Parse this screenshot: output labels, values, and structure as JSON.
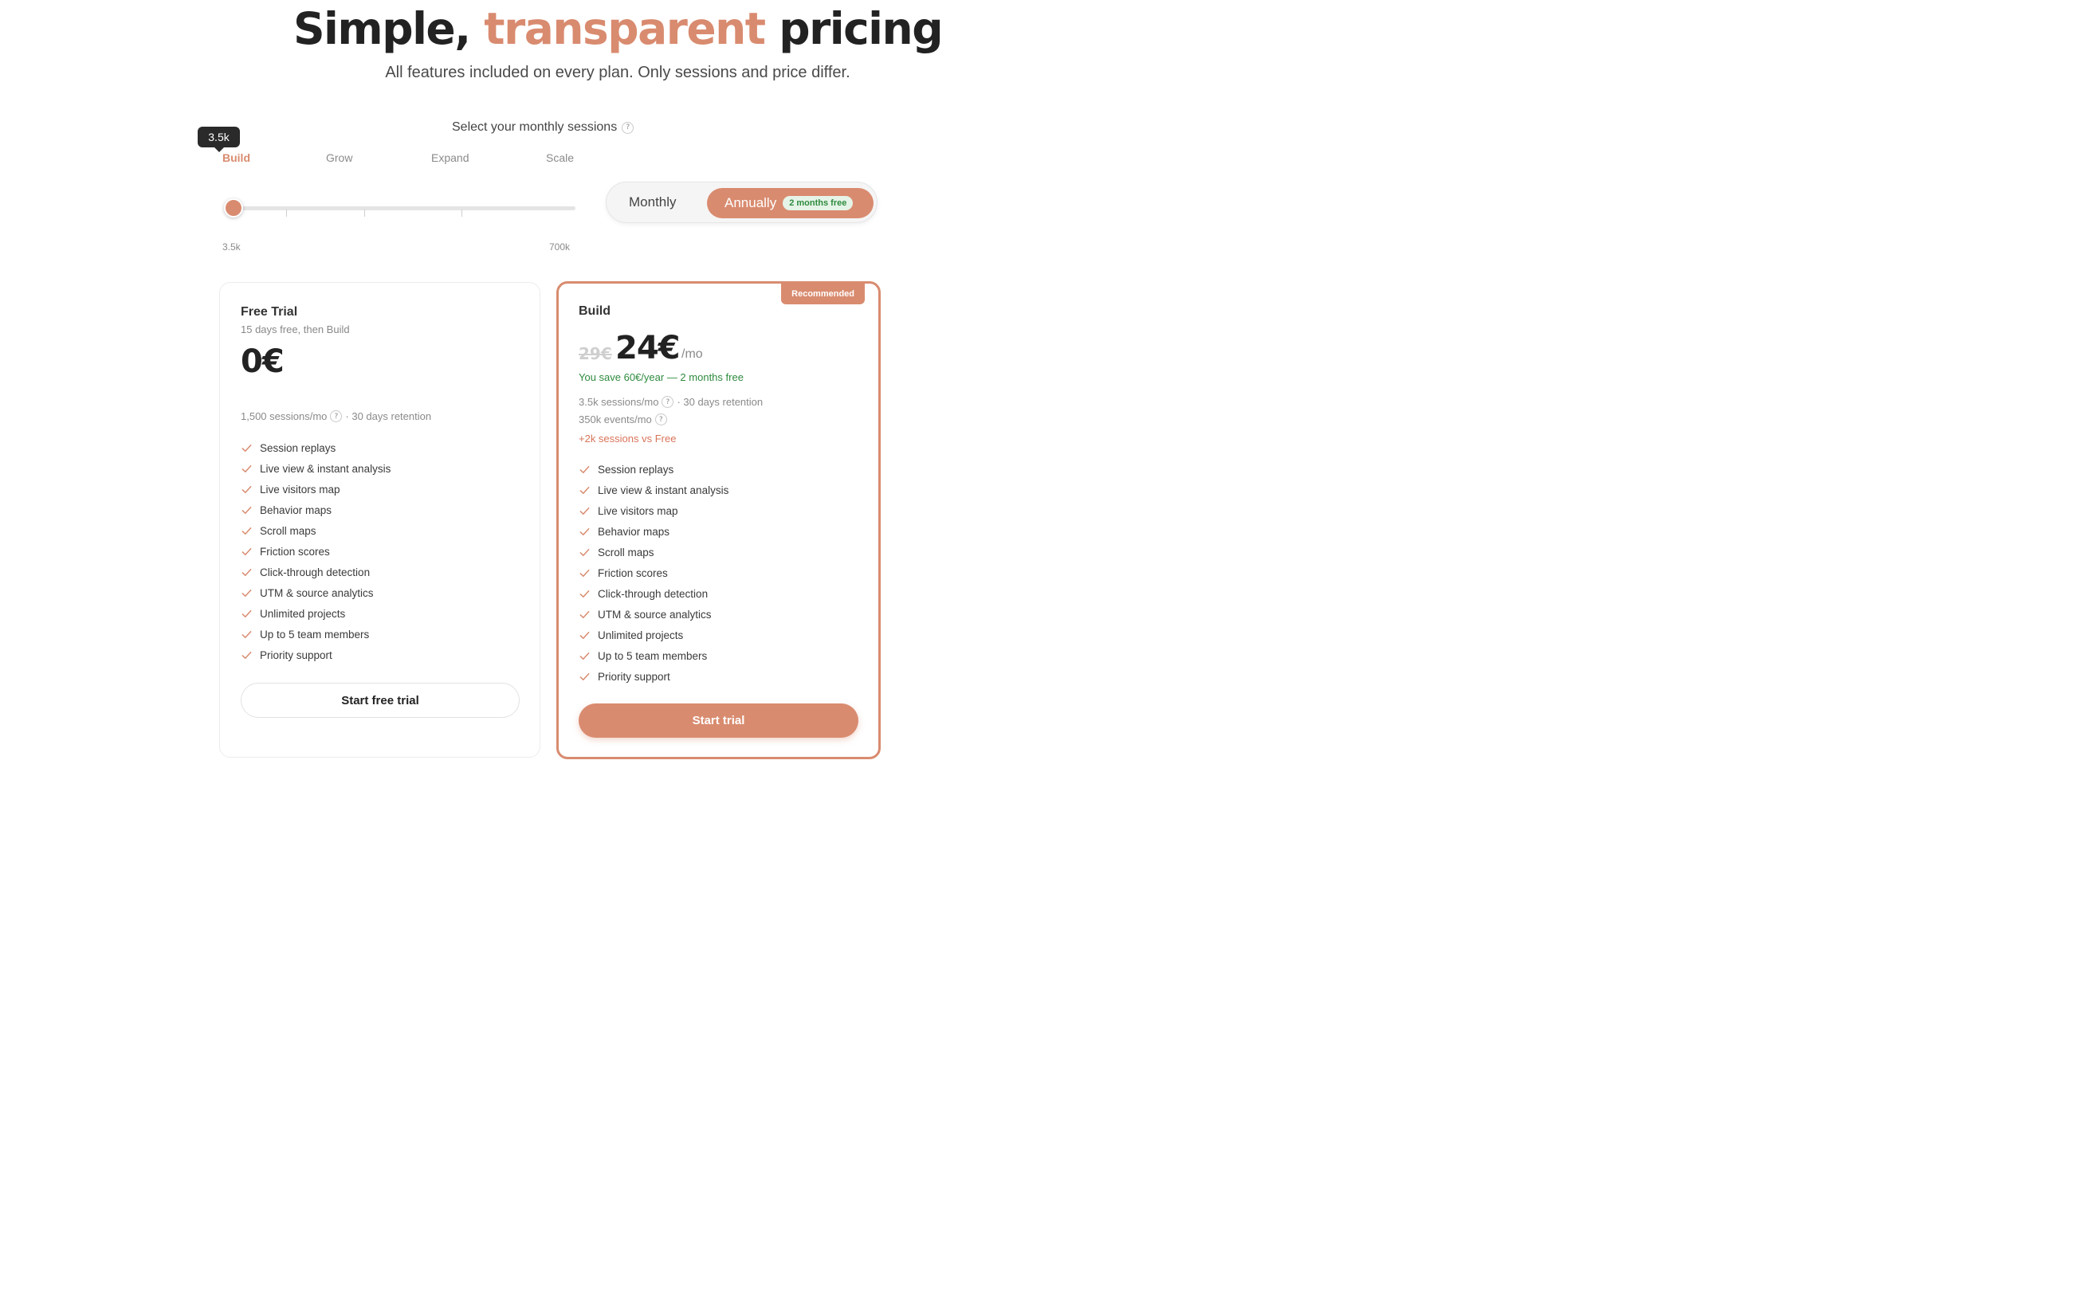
{
  "hero": {
    "title_part1": "Simple,",
    "title_accent": "transparent",
    "title_part2": "pricing",
    "subtitle": "All features included on every plan. Only sessions and price differ."
  },
  "slider": {
    "label": "Select your monthly sessions",
    "help": "?",
    "tooltip": "3.5k",
    "tiers": [
      "Build",
      "Grow",
      "Expand",
      "Scale"
    ],
    "active_tier": "Build",
    "min_label": "3.5k",
    "max_label": "700k",
    "position_fraction": 0.0
  },
  "billing": {
    "monthly_label": "Monthly",
    "annual_label": "Annually",
    "annual_badge": "2 months free",
    "selected": "Annually"
  },
  "plans": [
    {
      "name": "Free Trial",
      "subtitle": "15 days free, then Build",
      "price": "0€",
      "sessions": "1,500 sessions/mo",
      "retention": "· 30 days retention",
      "features": [
        "Session replays",
        "Live view & instant analysis",
        "Live visitors map",
        "Behavior maps",
        "Scroll maps",
        "Friction scores",
        "Click-through detection",
        "UTM & source analytics",
        "Unlimited projects",
        "Up to 5 team members",
        "Priority support"
      ],
      "cta": "Start free trial"
    },
    {
      "name": "Build",
      "badge": "Recommended",
      "old_price": "29€",
      "price": "24€",
      "period": "/mo",
      "savings": "You save 60€/year — 2 months free",
      "sessions": "3.5k sessions/mo",
      "retention": "· 30 days retention",
      "events": "350k events/mo",
      "vs_free": "+2k sessions vs Free",
      "features": [
        "Session replays",
        "Live view & instant analysis",
        "Live visitors map",
        "Behavior maps",
        "Scroll maps",
        "Friction scores",
        "Click-through detection",
        "UTM & source analytics",
        "Unlimited projects",
        "Up to 5 team members",
        "Priority support"
      ],
      "cta": "Start trial"
    }
  ],
  "colors": {
    "accent": "#d98b6f",
    "success": "#2e8b3e",
    "text": "#2b2b2b"
  },
  "icons": {
    "feature_check": "check-icon",
    "help": "question-circle-icon"
  }
}
